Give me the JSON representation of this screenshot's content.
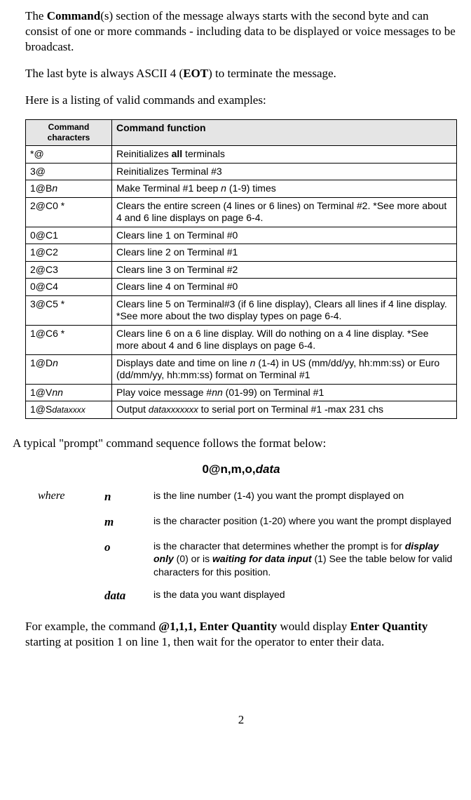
{
  "para1_a": "The ",
  "para1_b": "Command",
  "para1_c": "(s) section of the message always starts with the second byte and can consist of one or more commands - including data to be displayed or voice messages to be broadcast.",
  "para2_a": "The last byte is always ASCII 4 (",
  "para2_b": "EOT",
  "para2_c": ") to terminate the message.",
  "para3": "Here is a listing of valid commands and examples:",
  "th1": "Command characters",
  "th2": "Command function",
  "rows": [
    {
      "c": "*@",
      "f_a": "Reinitializes ",
      "f_b": "all",
      "f_c": " terminals"
    },
    {
      "c": "3@",
      "f": "Reinitializes Terminal #3"
    },
    {
      "c_a": "1@B",
      "c_i": "n",
      "f_a": "Make Terminal #1 beep ",
      "f_i": "n",
      "f_c": " (1-9) times"
    },
    {
      "c": "2@C0    *",
      "f": "Clears the entire screen (4 lines or 6 lines) on Terminal #2. *See more about 4 and 6 line displays on page 6-4."
    },
    {
      "c": "0@C1",
      "f": "Clears line 1 on Terminal #0"
    },
    {
      "c": "1@C2",
      "f": "Clears line 2 on Terminal #1"
    },
    {
      "c": "2@C3",
      "f": "Clears line 3 on Terminal #2"
    },
    {
      "c": "0@C4",
      "f": "Clears line 4 on Terminal #0"
    },
    {
      "c": "3@C5    *",
      "f": "Clears line 5 on Terminal#3 (if 6 line display), Clears all lines if 4 line display.  *See more about the two display types on page 6-4."
    },
    {
      "c": "1@C6    *",
      "f": "Clears line 6 on a 6 line display. Will do nothing on a 4 line display.  *See more about 4 and 6 line displays on page 6-4."
    },
    {
      "c_a": "1@D",
      "c_i": "n",
      "f_a": "Displays date and time on line ",
      "f_i": "n",
      "f_c": " (1-4) in US (mm/dd/yy, hh:mm:ss) or Euro (dd/mm/yy, hh:mm:ss) format on Terminal #1"
    },
    {
      "c_a": "1@V",
      "c_i": "nn",
      "f_a": "Play voice message #",
      "f_i": "nn",
      "f_c": "  (01-99) on Terminal #1"
    },
    {
      "c_a": "1@S",
      "c_i": "dataxxxx",
      "f_a": "Output ",
      "f_i": "dataxxxxxxx",
      "f_c": " to serial port on Terminal #1 -max 231 chs"
    }
  ],
  "para4": "A typical \"prompt\" command sequence follows the format below:",
  "formula_a": "0@n,m,o,",
  "formula_b": "data",
  "where": "where",
  "defs": [
    {
      "v": "n",
      "d": "is the line number (1-4) you want the prompt displayed on"
    },
    {
      "v": "m",
      "d": "is the character position (1-20) where you want the prompt displayed"
    },
    {
      "v": "o",
      "d_a": "is the character that determines whether the prompt is for ",
      "d_b": "display only",
      "d_c": " (0) or is ",
      "d_d": "waiting for data input",
      "d_e": " (1) See the table below for valid characters for this position."
    },
    {
      "v": "data",
      "d": "is the data you want displayed"
    }
  ],
  "para5_a": "For example, the command  ",
  "para5_b": "@1,1,1, Enter Quantity",
  "para5_c": " would display ",
  "para5_d": "Enter Quantity",
  "para5_e": " starting at position 1 on line 1, then wait for the operator to enter their data.",
  "pagenum": "2"
}
